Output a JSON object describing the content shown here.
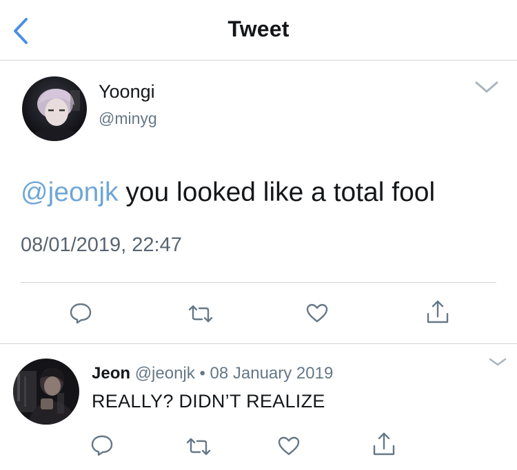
{
  "header": {
    "title": "Tweet",
    "back_icon": "chevron-left-icon",
    "accent": "#4a90e2"
  },
  "tweet": {
    "author": {
      "name": "Yoongi",
      "handle": "@minyg"
    },
    "text": {
      "mention": "@jeonjk",
      "body": " you looked like a total fool"
    },
    "timestamp": "08/01/2019, 22:47",
    "actions": [
      "reply-icon",
      "retweet-icon",
      "like-icon",
      "share-icon"
    ]
  },
  "reply": {
    "author": {
      "name": "Jeon",
      "handle": "@jeonjk"
    },
    "separator": "•",
    "date": "08 January 2019",
    "text": "REALLY? DIDN’T REALIZE",
    "actions": [
      "reply-icon",
      "retweet-icon",
      "like-icon",
      "share-icon"
    ]
  },
  "colors": {
    "mention": "#6fa6d6",
    "muted": "#657786",
    "icon": "#657786",
    "divider": "#d0d4d8"
  }
}
